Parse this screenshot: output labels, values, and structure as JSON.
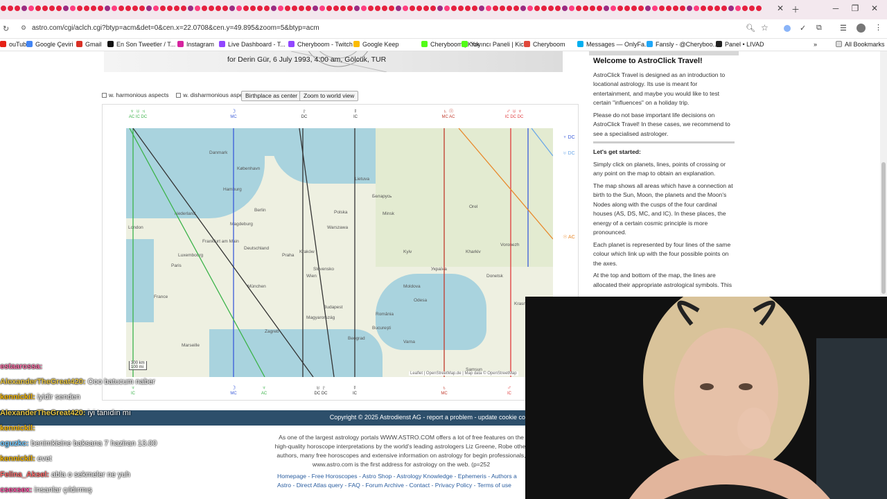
{
  "browser": {
    "url": "astro.com/cgi/aclch.cgi?btyp=acm&det=0&cen.x=22.0708&cen.y=49.895&zoom=5&btyp=acm",
    "bookmarks": [
      {
        "label": "ouTube",
        "color": "#e62117"
      },
      {
        "label": "Google Çeviri",
        "color": "#4285f4"
      },
      {
        "label": "Gmail",
        "color": "#d93025"
      },
      {
        "label": "En Son Tweetler / T...",
        "color": "#111111"
      },
      {
        "label": "Instagram",
        "color": "#d6249f"
      },
      {
        "label": "Live Dashboard - T...",
        "color": "#9146ff"
      },
      {
        "label": "Cheryboom - Twitch",
        "color": "#9146ff"
      },
      {
        "label": "Google Keep",
        "color": "#fbbc04"
      },
      {
        "label": "Cheryboom | Kick",
        "color": "#53fc18"
      },
      {
        "label": "Yayıncı Paneli | Kick",
        "color": "#53fc18"
      },
      {
        "label": "Cheryboom",
        "color": "#e0483b"
      },
      {
        "label": "Messages — OnlyFa...",
        "color": "#00aff0"
      },
      {
        "label": "Fansly - @Cheryboo...",
        "color": "#1fa7f8"
      },
      {
        "label": "Panel • LIVAD",
        "color": "#222222"
      }
    ],
    "all_bookmarks": "All Bookmarks"
  },
  "page": {
    "person_line": "for Derin Gür, 6 July 1993, 4:00 am, Gölcük, TUR",
    "harmonious": "w. harmonious aspects",
    "disharmonious": "w. disharmonious aspects",
    "birthplace_btn": "Birthplace as center",
    "zoom_btn": "Zoom to world view",
    "map_attribution": "Leaflet | OpenStreetMap.de | Map data © OpenStreetMap",
    "scale_km": "300 km",
    "scale_mi": "100 mi"
  },
  "map_labels": [
    {
      "t": "Danmark"
    },
    {
      "t": "København"
    },
    {
      "t": "Nederland"
    },
    {
      "t": "Berlin"
    },
    {
      "t": "Polska"
    },
    {
      "t": "Warszawa"
    },
    {
      "t": "Magdeburg"
    },
    {
      "t": "Deutschland"
    },
    {
      "t": "Paris"
    },
    {
      "t": "France"
    },
    {
      "t": "Luxembourg"
    },
    {
      "t": "Praha"
    },
    {
      "t": "Kraków"
    },
    {
      "t": "Wien"
    },
    {
      "t": "München"
    },
    {
      "t": "Slovensko"
    },
    {
      "t": "Budapest"
    },
    {
      "t": "Magyarország"
    },
    {
      "t": "Zagreb"
    },
    {
      "t": "Beograd"
    },
    {
      "t": "România"
    },
    {
      "t": "Bucureşti"
    },
    {
      "t": "Kyiv"
    },
    {
      "t": "Україна"
    },
    {
      "t": "Moldova"
    },
    {
      "t": "Odesa"
    },
    {
      "t": "Беларусь"
    },
    {
      "t": "Minsk"
    },
    {
      "t": "Lietuva"
    },
    {
      "t": "Marseille"
    },
    {
      "t": "Varna"
    },
    {
      "t": "Samsun"
    },
    {
      "t": "Orel"
    },
    {
      "t": "Voronezh"
    },
    {
      "t": "Kharkiv"
    },
    {
      "t": "Donetsk"
    },
    {
      "t": "Krasnodar"
    },
    {
      "t": "London"
    },
    {
      "t": "Hamburg"
    },
    {
      "t": "Frankfurt am Main"
    }
  ],
  "top_symbols": [
    {
      "g": "♆ ♅ ♃",
      "l": "AC IC DC"
    },
    {
      "g": "☽",
      "l": "MC"
    },
    {
      "g": "♇",
      "l": "DC"
    },
    {
      "g": "☿",
      "l": "IC"
    },
    {
      "g": "♄ ☉",
      "l": "MC AC"
    },
    {
      "g": "♂ ♅ ♆",
      "l": "IC DC DC"
    }
  ],
  "right_symbols": [
    {
      "g": "♆ DC"
    },
    {
      "g": "♅ DC"
    },
    {
      "g": "☉ AC"
    }
  ],
  "bottom_symbols": [
    {
      "g": "♆",
      "l": "IC"
    },
    {
      "g": "☽",
      "l": "MC"
    },
    {
      "g": "♆",
      "l": "AC"
    },
    {
      "g": "♅ ♇",
      "l": "DC DC"
    },
    {
      "g": "☿",
      "l": "IC"
    },
    {
      "g": "♄",
      "l": "MC"
    },
    {
      "g": "♂",
      "l": "IC"
    }
  ],
  "sidebar": {
    "title": "Welcome to AstroClick Travel!",
    "p1": "AstroClick Travel is designed as an introduction to locational astrology. Its use is meant for entertainment, and maybe you would like to test certain \"influences\" on a holiday trip.",
    "p2": "Please do not base important life decisions on AstroClick Travel! In these cases, we recommend to see a specialised astrologer.",
    "sub": "Let's get started:",
    "p3": "Simply click on planets, lines, points of crossing or any point on the map to obtain an explanation.",
    "p4": "The map shows all areas which have a connection at birth to the Sun, Moon, the planets and the Moon's Nodes along with the cusps of the four cardinal houses (AS, DS, MC, and IC). In these places, the energy of a certain cosmic principle is more pronounced.",
    "p5": "Each planet is represented by four lines of the same colour which link up with the four possible points on the axes.",
    "p6": "At the top and bottom of the map, the lines are allocated their appropriate astrological symbols. This"
  },
  "footer": {
    "copyright": "Copyright © 2025 Astrodienst AG  -  report a problem  -  update cookie co",
    "text": "As one of the largest astrology portals WWW.ASTRO.COM offers a lot of free features on the high-quality horoscope interpretations by the world's leading astrologers Liz Greene, Robe other authors, many free horoscopes and extensive information on astrology for begin professionals, www.astro.com is the first address for astrology on the web. (p=252",
    "links1": "Homepage - Free Horoscopes - Astro Shop - Astrology Knowledge - Ephemeris - Authors a",
    "links2": "Astro - Direct Atlas query - FAQ - Forum Archive - Contact - Privacy Policy - Terms of use"
  },
  "chat": [
    {
      "user": "estaarossa:",
      "msg": "",
      "color": "#ff6fa8"
    },
    {
      "user": "AlexanderTheGreat420:",
      "msg": "Ooo batucum naber",
      "color": "#e8c542"
    },
    {
      "user": "kennickil:",
      "msg": "iyidir senden",
      "color": "#f0b400"
    },
    {
      "user": "AlexanderTheGreat420:",
      "msg": "iyi tanıdın mı",
      "color": "#e8c542"
    },
    {
      "user": "kennickil:",
      "msg": "",
      "color": "#f0b400"
    },
    {
      "user": "oguzkc:",
      "msg": "benimkisine baksana 7 haziran 13.00",
      "color": "#6ec8ff"
    },
    {
      "user": "kennickil:",
      "msg": "evet",
      "color": "#f0b400"
    },
    {
      "user": "Felina_Aksel:",
      "msg": "abla o sekmeler ne yuh",
      "color": "#ff6b6b"
    },
    {
      "user": "csexsex:",
      "msg": "insanlar çıldırmış",
      "color": "#ff4fa3"
    }
  ]
}
